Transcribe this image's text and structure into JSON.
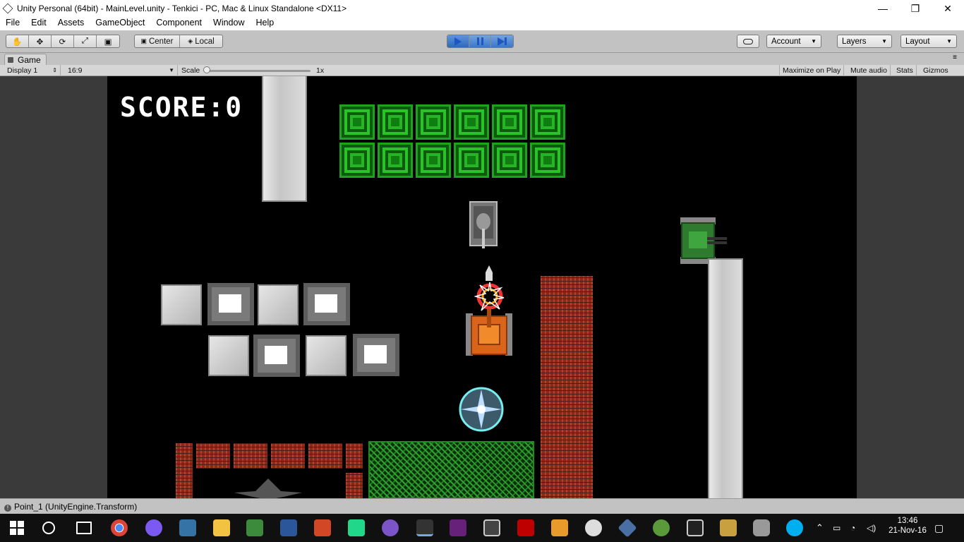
{
  "window": {
    "title": "Unity Personal (64bit) - MainLevel.unity - Tenkici - PC, Mac & Linux Standalone <DX11>",
    "minimize": "—",
    "maximize": "❐",
    "close": "✕"
  },
  "menu": [
    "File",
    "Edit",
    "Assets",
    "GameObject",
    "Component",
    "Window",
    "Help"
  ],
  "toolbar": {
    "tools": [
      "✋",
      "✥",
      "⟳",
      "⤢",
      "▣"
    ],
    "pivot": "Center",
    "space": "Local",
    "cloud_icon": "cloud-icon",
    "account": "Account",
    "layers": "Layers",
    "layout": "Layout"
  },
  "game_tab": {
    "label": "Game"
  },
  "game_bar": {
    "display": "Display 1",
    "aspect": "16:9",
    "scale_label": "Scale",
    "scale_value": "1x",
    "maximize": "Maximize on Play",
    "mute": "Mute audio",
    "stats": "Stats",
    "gizmos": "Gizmos"
  },
  "game": {
    "score": "SCORE:0"
  },
  "status": {
    "message": "Point_1 (UnityEngine.Transform)"
  },
  "tray": {
    "time": "13:46",
    "date": "21-Nov-16"
  },
  "colors": {
    "accent_play": "#3d78c4",
    "crate_green": "#1ea31e",
    "brick": "#8a2a1c"
  }
}
